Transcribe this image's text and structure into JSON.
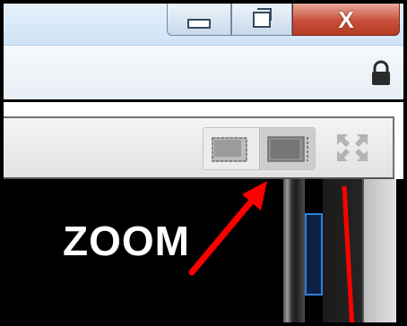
{
  "window": {
    "minimize_icon": "minimize-icon",
    "maximize_icon": "restore-icon",
    "close_label": "X"
  },
  "address_bar": {
    "lock_icon": "lock-icon"
  },
  "toolbar": {
    "normal_view_icon": "normal-view-icon",
    "zoom_view_icon": "zoom-view-icon",
    "fullscreen_icon": "fullscreen-icon",
    "zoom_view_selected": true
  },
  "annotation": {
    "label": "ZOOM",
    "color": "#ff0000"
  }
}
